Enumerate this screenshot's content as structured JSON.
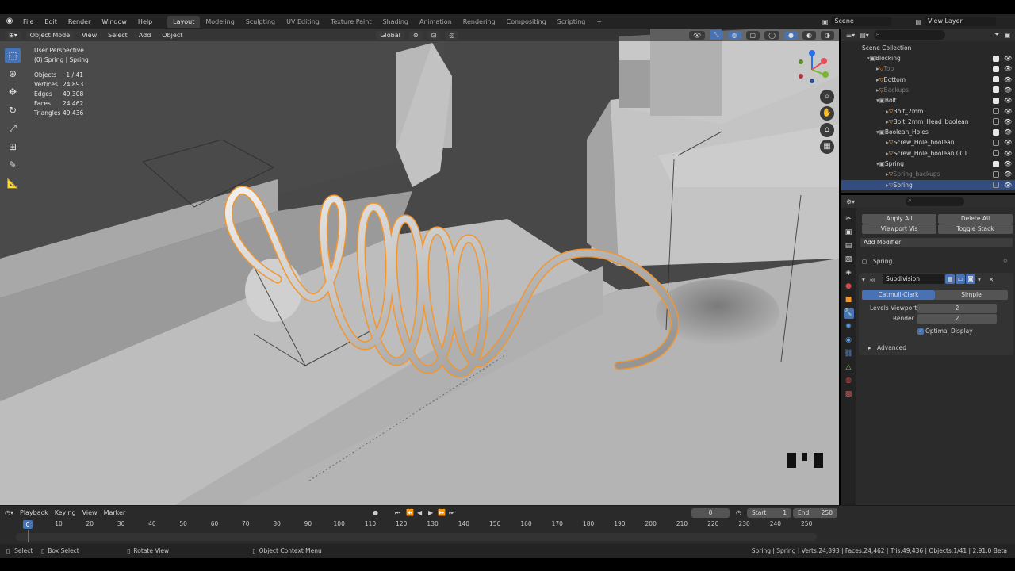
{
  "menu": [
    "File",
    "Edit",
    "Render",
    "Window",
    "Help"
  ],
  "workspaces": [
    {
      "label": "Layout",
      "active": true
    },
    {
      "label": "Modeling",
      "active": false
    },
    {
      "label": "Sculpting",
      "active": false
    },
    {
      "label": "UV Editing",
      "active": false
    },
    {
      "label": "Texture Paint",
      "active": false
    },
    {
      "label": "Shading",
      "active": false
    },
    {
      "label": "Animation",
      "active": false
    },
    {
      "label": "Rendering",
      "active": false
    },
    {
      "label": "Compositing",
      "active": false
    },
    {
      "label": "Scripting",
      "active": false
    }
  ],
  "scene_name": "Scene",
  "view_layer": "View Layer",
  "viewport_header": {
    "mode": "Object Mode",
    "view": "View",
    "select": "Select",
    "add": "Add",
    "object": "Object",
    "transform": "Global"
  },
  "overlay": {
    "perspective": "User Perspective",
    "context": "(0) Spring | Spring",
    "stats": [
      {
        "key": "Objects",
        "value": "1 / 41"
      },
      {
        "key": "Vertices",
        "value": "24,893"
      },
      {
        "key": "Edges",
        "value": "49,308"
      },
      {
        "key": "Faces",
        "value": "24,462"
      },
      {
        "key": "Triangles",
        "value": "49,436"
      }
    ]
  },
  "outliner": {
    "root": "Scene Collection",
    "rows": [
      {
        "name": "Blocking",
        "kind": "collection",
        "dim": false,
        "checked": true
      },
      {
        "name": "Top",
        "kind": "object",
        "dim": true,
        "checked": true
      },
      {
        "name": "Bottom",
        "kind": "object",
        "dim": false,
        "checked": true
      },
      {
        "name": "Backups",
        "kind": "object",
        "dim": true,
        "checked": true
      },
      {
        "name": "Bolt",
        "kind": "collection",
        "dim": false,
        "checked": true
      },
      {
        "name": "Bolt_2mm",
        "kind": "mesh",
        "dim": false,
        "checked": false
      },
      {
        "name": "Bolt_2mm_Head_boolean",
        "kind": "mesh",
        "dim": false,
        "checked": false
      },
      {
        "name": "Boolean_Holes",
        "kind": "collection",
        "dim": false,
        "checked": true
      },
      {
        "name": "Screw_Hole_boolean",
        "kind": "mesh",
        "dim": false,
        "checked": false
      },
      {
        "name": "Screw_Hole_boolean.001",
        "kind": "mesh",
        "dim": false,
        "checked": false
      },
      {
        "name": "Spring",
        "kind": "collection",
        "dim": false,
        "checked": true
      },
      {
        "name": "Spring_backups",
        "kind": "object",
        "dim": true,
        "checked": false
      },
      {
        "name": "Spring",
        "kind": "mesh",
        "dim": false,
        "checked": false,
        "selected": true
      }
    ]
  },
  "properties": {
    "apply_all": "Apply All",
    "delete_all": "Delete All",
    "viewport_vis": "Viewport Vis",
    "toggle_stack": "Toggle Stack",
    "add_modifier": "Add Modifier",
    "object_name": "Spring",
    "modifier_name": "Subdivision",
    "type_catmull": "Catmull-Clark",
    "type_simple": "Simple",
    "levels_viewport_label": "Levels Viewport",
    "levels_viewport": "2",
    "render_label": "Render",
    "render_value": "2",
    "optimal_display": "Optimal Display",
    "advanced": "Advanced"
  },
  "timeline": {
    "playback": "Playback",
    "keying": "Keying",
    "view": "View",
    "marker": "Marker",
    "current_frame": "0",
    "start_label": "Start",
    "start": "1",
    "end_label": "End",
    "end": "250",
    "cursor": "0",
    "ticks": [
      "10",
      "20",
      "30",
      "40",
      "50",
      "60",
      "70",
      "80",
      "90",
      "100",
      "110",
      "120",
      "130",
      "140",
      "150",
      "160",
      "170",
      "180",
      "190",
      "200",
      "210",
      "220",
      "230",
      "240",
      "250"
    ]
  },
  "statusbar": {
    "select": "Select",
    "box_select": "Box Select",
    "rotate_view": "Rotate View",
    "context_menu": "Object Context Menu",
    "info": "Spring | Spring | Verts:24,893 | Faces:24,462 | Tris:49,436 | Objects:1/41 | 2.91.0 Beta"
  },
  "colors": {
    "accent": "#4772b3",
    "selection_orange": "#f3962d",
    "viewport_bg": "#444444"
  }
}
